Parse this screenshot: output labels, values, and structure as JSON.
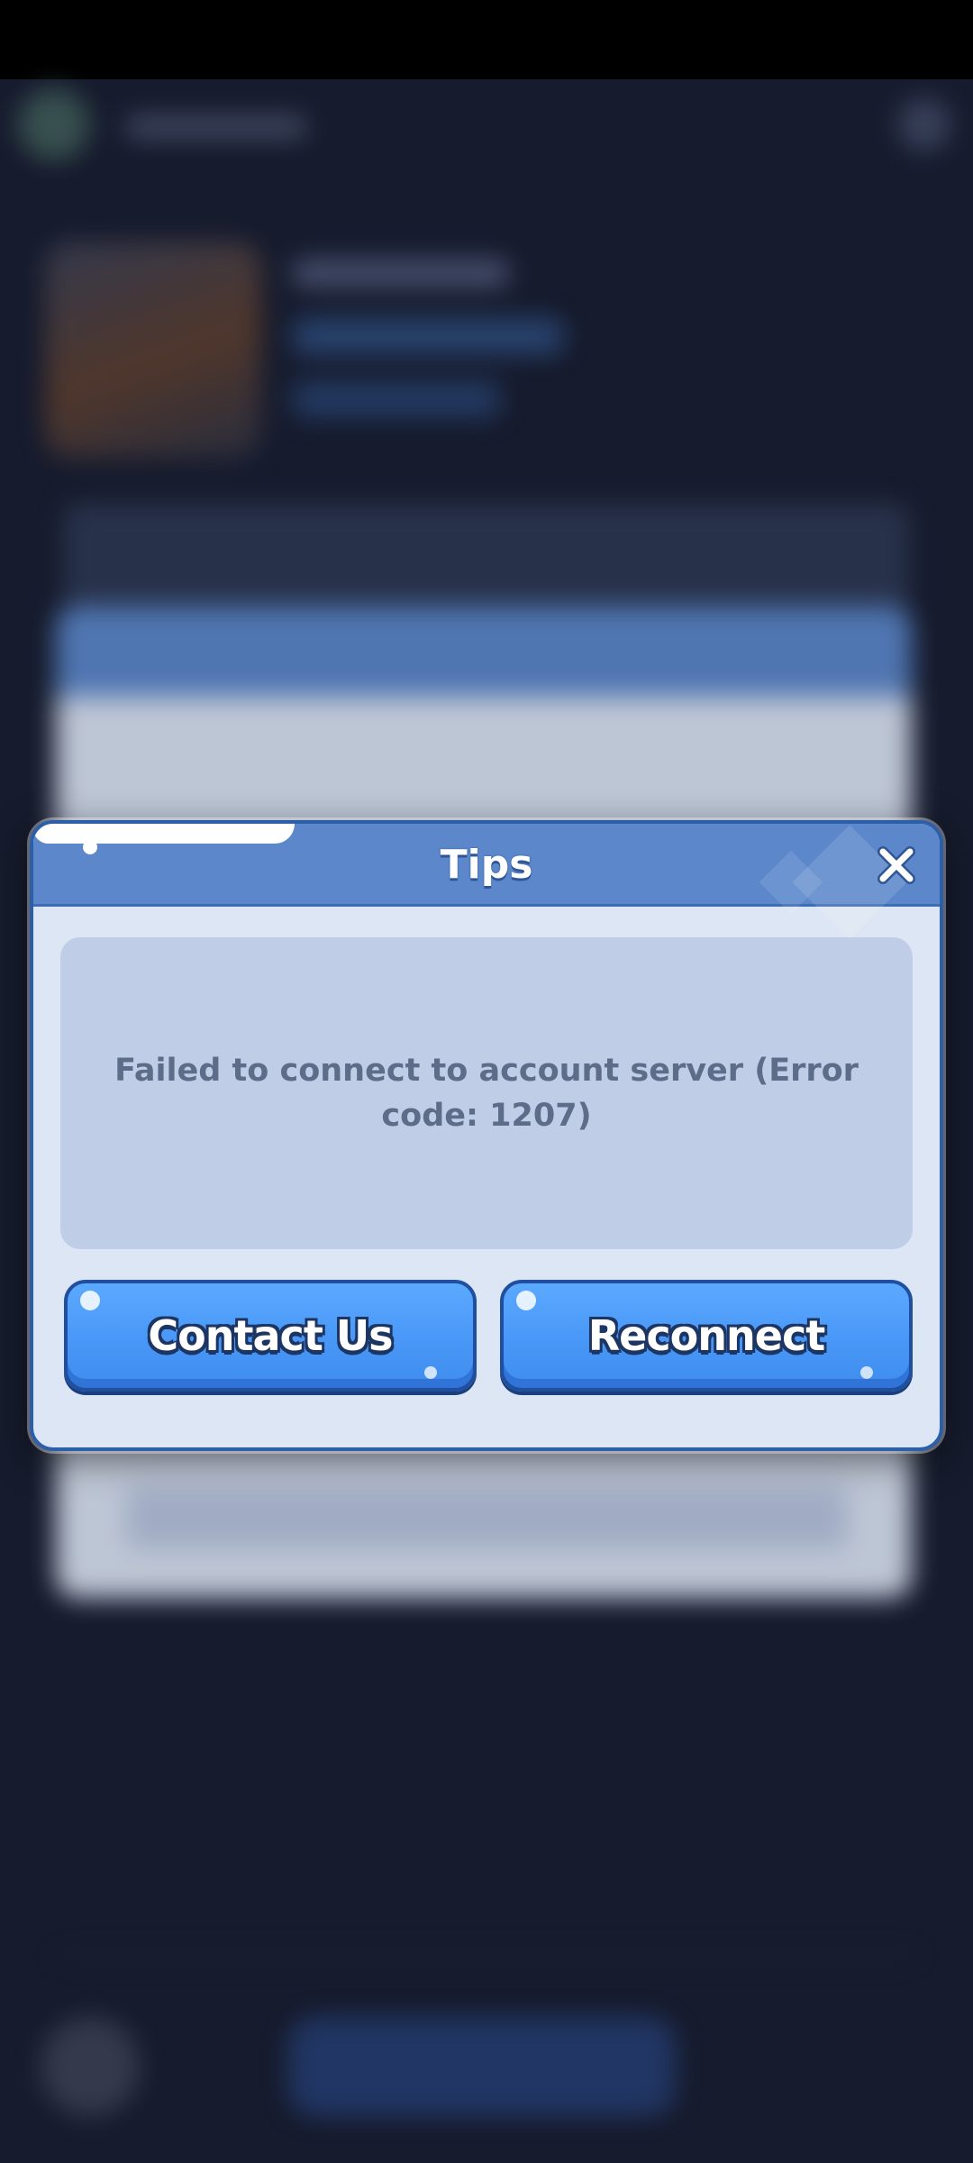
{
  "dialog": {
    "title": "Tips",
    "message": "Failed to connect to account server (Error code: 1207)",
    "buttons": {
      "contact": "Contact Us",
      "reconnect": "Reconnect"
    }
  },
  "icons": {
    "close": "close-icon"
  },
  "colors": {
    "header": "#5c88cb",
    "button": "#4796f6",
    "message_bg": "#bfcde6",
    "background": "#161b2d"
  }
}
